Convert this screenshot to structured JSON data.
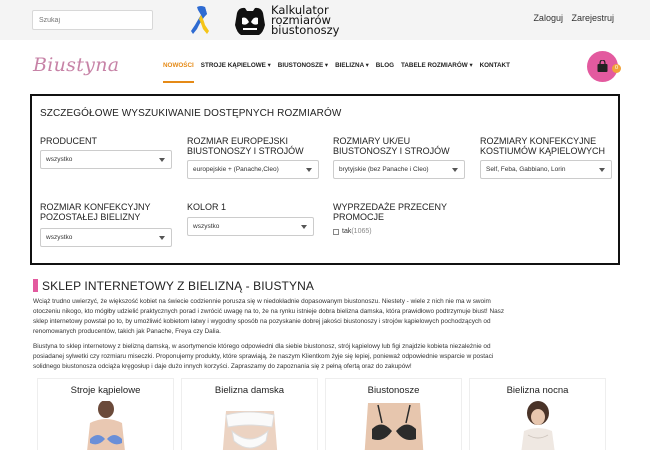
{
  "topbar": {
    "search_placeholder": "Szukaj",
    "calc_lines": [
      "Kalkulator",
      "rozmiarów",
      "biustonoszy"
    ],
    "login": "Zaloguj",
    "register": "Zarejestruj"
  },
  "nav": {
    "brand": "Biustyna",
    "items": [
      {
        "label": "NOWOŚCI"
      },
      {
        "label": "STROJE KĄPIELOWE ▾"
      },
      {
        "label": "BIUSTONOSZE ▾"
      },
      {
        "label": "BIELIZNA ▾"
      },
      {
        "label": "BLOG"
      },
      {
        "label": "TABELE ROZMIARÓW ▾"
      },
      {
        "label": "KONTAKT"
      }
    ],
    "cart_count": "0",
    "colors": {
      "accent": "#e58a16",
      "pink": "#e35a9f",
      "badge": "#f1a23a"
    }
  },
  "filters": {
    "title": "SZCZEGÓŁOWE WYSZUKIWANIE DOSTĘPNYCH ROZMIARÓW",
    "producent": {
      "label": "PRODUCENT",
      "value": "wszystko"
    },
    "eu": {
      "label1": "ROZMIAR EUROPEJSKI",
      "label2": "BIUSTONOSZY I STROJÓW",
      "value": "europejskie + (Panache,Cleo)"
    },
    "uk": {
      "label1": "ROZMIARY UK/EU",
      "label2": "BIUSTONOSZY I STROJÓW",
      "value": "brytyjskie (bez Panache i Cleo)"
    },
    "kostiumy": {
      "label1": "ROZMIARY KONFEKCYJNE",
      "label2": "KOSTIUMÓW KĄPIELOWYCH",
      "value": "Self, Feba, Gabbiano, Lorin"
    },
    "bielizna": {
      "label1": "ROZMIAR KONFEKCYJNY",
      "label2": "POZOSTAŁEJ BIELIZNY",
      "value": "wszystko"
    },
    "kolor": {
      "label": "KOLOR 1",
      "value": "wszystko"
    },
    "promo": {
      "label1": "WYPRZEDAŻE PRZECENY",
      "label2": "PROMOCJE",
      "option": "tak",
      "count": "(1065)"
    }
  },
  "section": {
    "title": "SKLEP INTERNETOWY Z BIELIZNĄ - BIUSTYNA",
    "p1": [
      "Wciąż trudno uwierzyć, że większość kobiet na świecie codziennie porusza się w niedokładnie dopasowanym biustonoszu. Niestety - wiele z nich nie ma w swoim",
      "otoczeniu nikogo, kto mógłby udzielić praktycznych porad i zwrócić uwagę na to, że na rynku istnieje dobra bielizna damska, która prawidłowo podtrzymuje biust! Nasz",
      "sklep internetowy powstał po to, by umożliwić kobietom łatwy i wygodny sposób na pozyskanie dobrej jakości biustonoszy i strojów kąpielowych pochodzących od",
      "renomowanych producentów, takich jak Panache, Freya czy Dalia."
    ],
    "p2": [
      "Biustyna to sklep internetowy z bielizną damską, w asortymencie którego odpowiedni dla siebie biustonosz, strój kąpielowy lub figi znajdzie kobieta niezależnie od",
      "posiadanej sylwetki czy rozmiaru miseczki. Proponujemy produkty, które sprawiają, że naszym Klientkom żyje się lepiej, ponieważ odpowiednie wsparcie w postaci",
      "solidnego biustonosza odciąża kręgosłup i daje dużo innych korzyści. Zapraszamy do zapoznania się z pełną ofertą oraz do zakupów!"
    ]
  },
  "cards": [
    {
      "title": "Stroje kąpielowe"
    },
    {
      "title": "Bielizna damska"
    },
    {
      "title": "Biustonosze"
    },
    {
      "title": "Bielizna nocna"
    }
  ]
}
